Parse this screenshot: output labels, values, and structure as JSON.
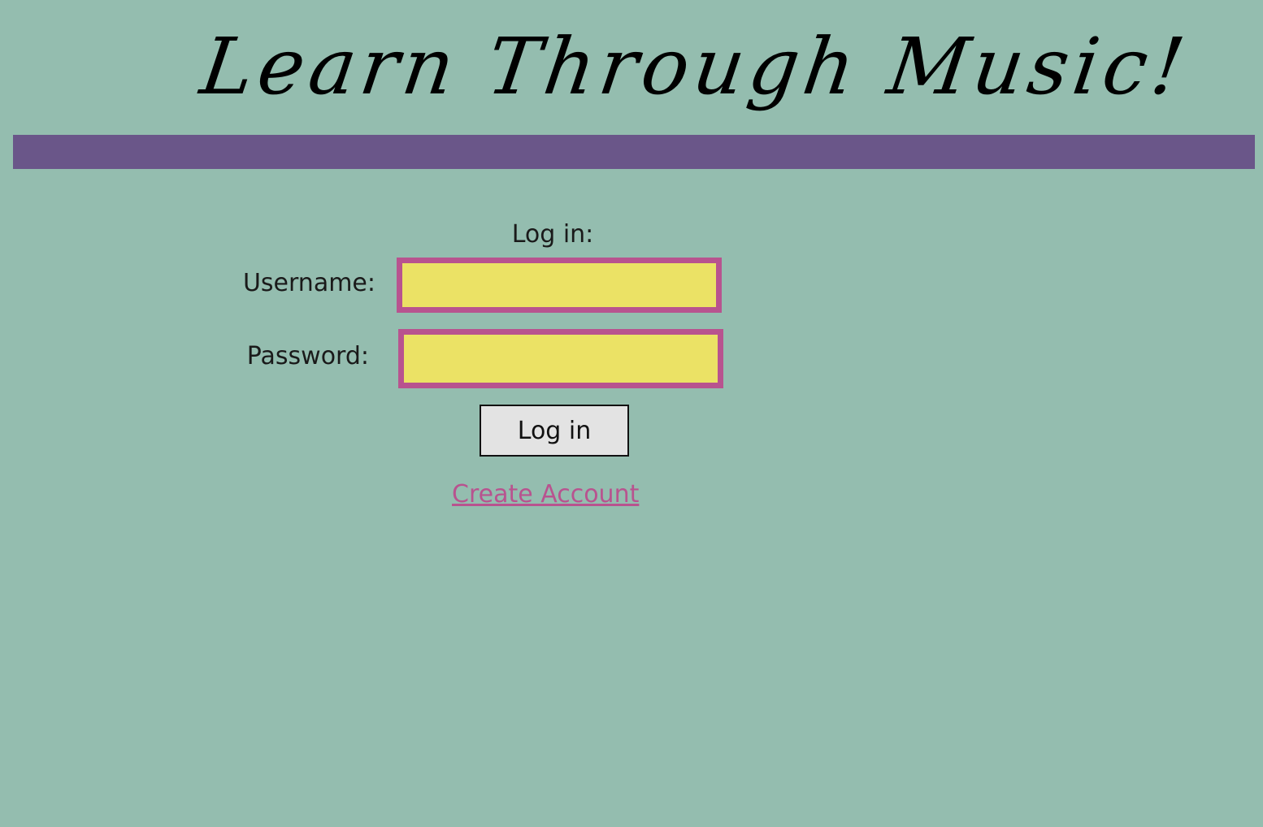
{
  "header": {
    "title": "Learn Through Music!"
  },
  "login_form": {
    "heading": "Log in:",
    "username_label": "Username:",
    "username_value": "",
    "password_label": "Password:",
    "password_value": "",
    "submit_label": "Log in",
    "create_account_label": "Create Account"
  },
  "colors": {
    "background": "#94bdaf",
    "header_bar": "#6a5689",
    "input_fill": "#ebe265",
    "input_border": "#b8538f",
    "link": "#b8538f",
    "button_fill": "#e3e3e3"
  }
}
